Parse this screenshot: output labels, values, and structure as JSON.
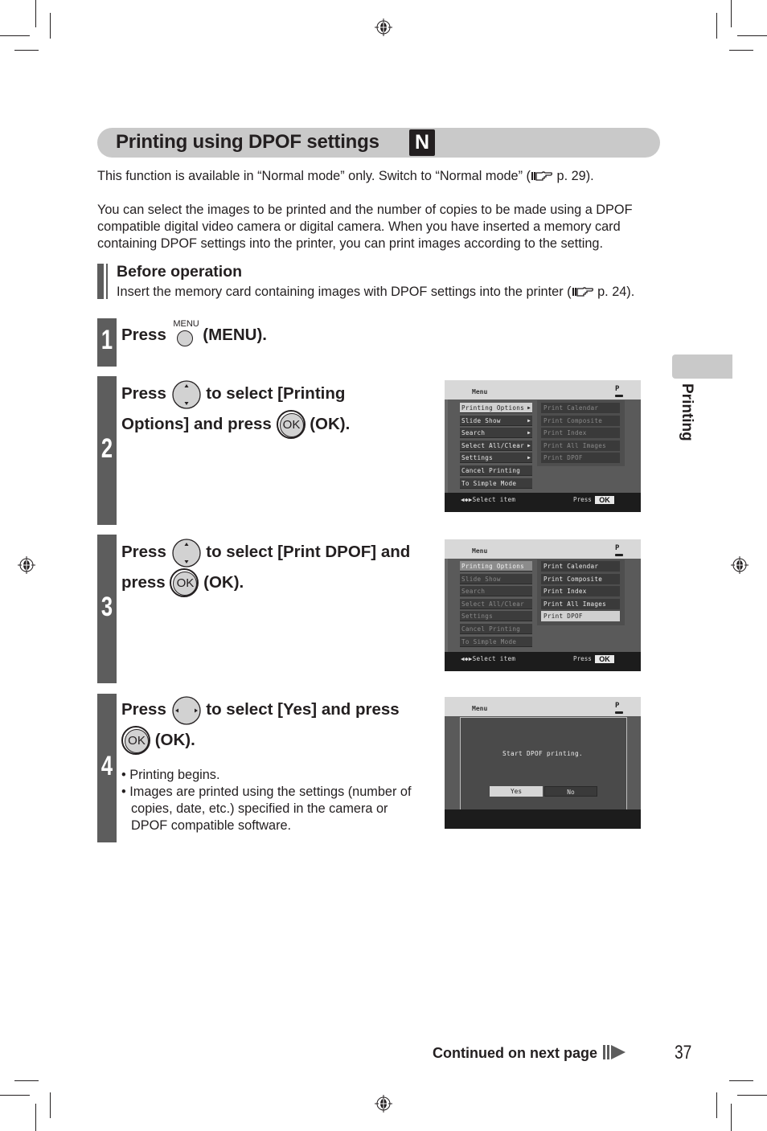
{
  "section": {
    "title": "Printing using DPOF settings",
    "mode_badge": "N"
  },
  "intro": {
    "availability_pre": "This function is available in “Normal mode” only. Switch to “Normal mode” (",
    "availability_ref": " p. 29).",
    "description": "You can select the images to be printed and the number of copies to be made using a DPOF compatible digital video camera or digital camera. When you have inserted a memory card containing DPOF settings into the printer, you can print images according to the setting."
  },
  "before_operation": {
    "heading": "Before operation",
    "text_pre": "Insert the memory card containing images with DPOF settings into the printer (",
    "text_ref": " p. 24)."
  },
  "steps": [
    {
      "number": "1",
      "press": "Press",
      "button_caption": "MENU",
      "suffix": "(MENU)."
    },
    {
      "number": "2",
      "press": "Press",
      "line1_rest": "to select [Printing",
      "line2_pre": "Options] and press",
      "suffix": "(OK).",
      "ok_label": "OK"
    },
    {
      "number": "3",
      "press": "Press",
      "line1_rest": "to select [Print DPOF] and",
      "line2_pre": "press",
      "suffix": "(OK).",
      "ok_label": "OK"
    },
    {
      "number": "4",
      "press": "Press",
      "line1_rest": "to select [Yes] and press",
      "suffix": "(OK).",
      "ok_label": "OK",
      "bullets": [
        "Printing begins.",
        "Images are printed using the settings (number of copies, date, etc.) specified in the camera or DPOF compatible software."
      ]
    }
  ],
  "screens": {
    "menu_title": "Menu",
    "printer_icon_letter": "P",
    "main_menu": [
      "Printing Options",
      "Slide Show",
      "Search",
      "Select All/Clear",
      "Settings",
      "Cancel Printing",
      "To Simple Mode"
    ],
    "sub_menu": [
      "Print Calendar",
      "Print Composite",
      "Print Index",
      "Print All Images",
      "Print DPOF"
    ],
    "hint": "Select item",
    "press": "Press",
    "ok": "OK",
    "screen1_selected": "Printing Options",
    "screen2_selected": "Print DPOF",
    "dialog": {
      "message": "Start DPOF printing.",
      "yes": "Yes",
      "no": "No",
      "selected": "Yes"
    }
  },
  "side_tab": {
    "label": "Printing"
  },
  "footer": {
    "continued": "Continued on next page",
    "page_number": "37"
  }
}
